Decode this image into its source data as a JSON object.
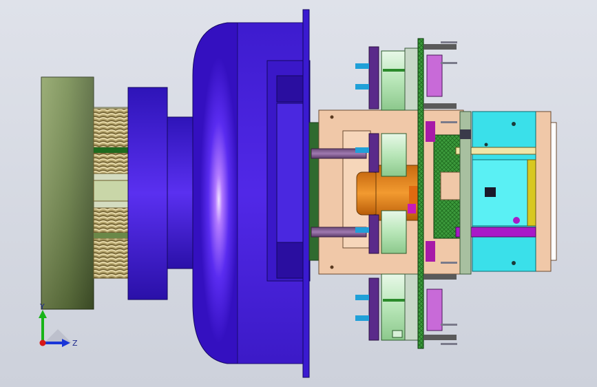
{
  "view": {
    "background_top": "#dfe2ea",
    "background_bottom": "#cdd1db"
  },
  "triad": {
    "y_label": "Y",
    "z_label": "Z",
    "y_color": "#18b418",
    "z_color": "#1a36d8",
    "x_color": "#d81818"
  },
  "parts": [
    "end-disc",
    "coil-springs",
    "flange-ring",
    "hub",
    "main-housing",
    "mounting-plate",
    "circuit-boards",
    "motor-assemblies",
    "carriage-plate",
    "cyan-block"
  ]
}
